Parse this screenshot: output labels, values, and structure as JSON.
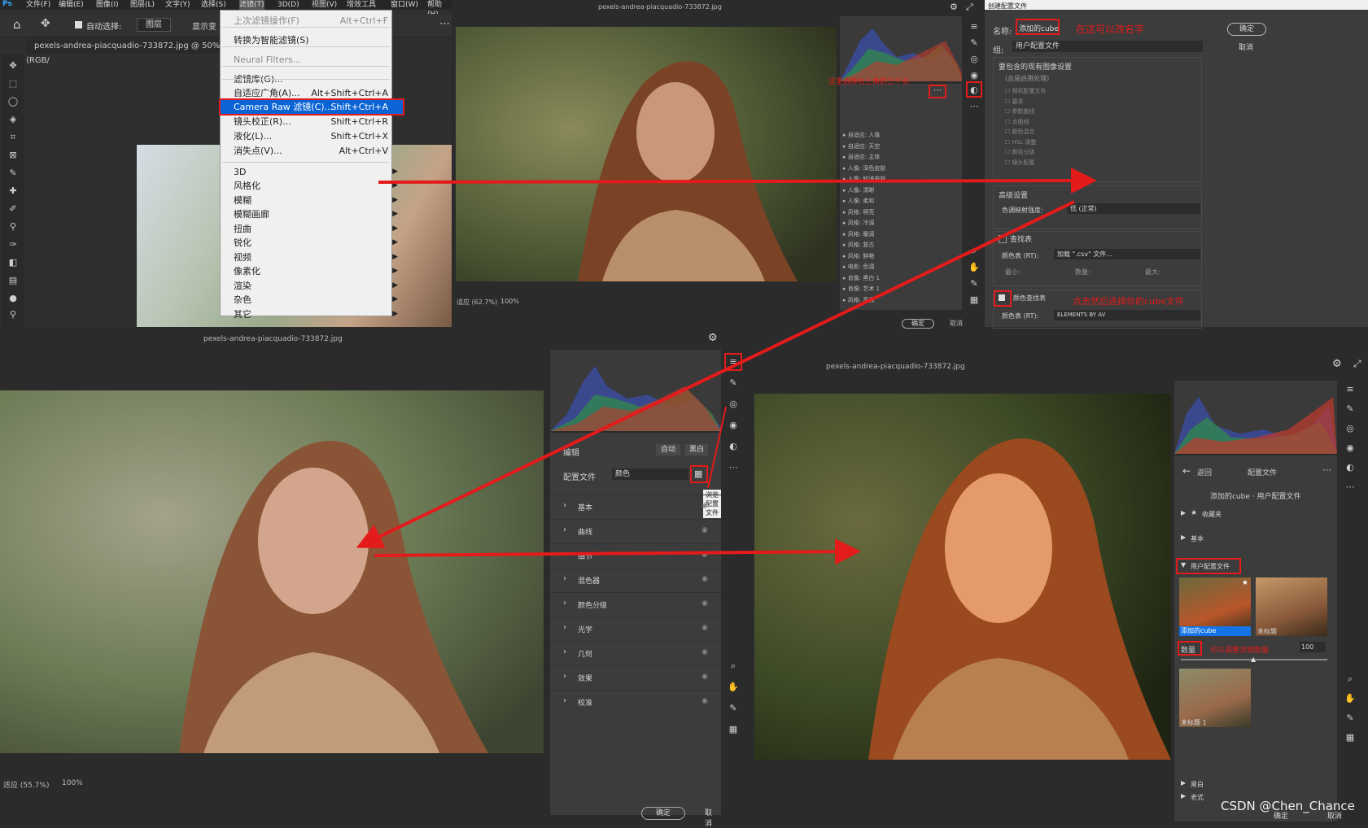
{
  "ps_menubar": {
    "logo": "Ps",
    "items": [
      "文件(F)",
      "编辑(E)",
      "图像(I)",
      "图层(L)",
      "文字(Y)",
      "选择(S)",
      "滤镜(T)",
      "3D(D)",
      "视图(V)",
      "增效工具",
      "窗口(W)",
      "帮助(H)"
    ]
  },
  "ps_options": {
    "auto_select_label": "自动选择:",
    "layer_select": "图层",
    "show_transform": "显示变"
  },
  "ps_tab": {
    "title": "pexels-andrea-piacquadio-733872.jpg @ 50%(RGB/"
  },
  "filter_menu": {
    "items": [
      {
        "label": "上次滤镜操作(F)",
        "shortcut": "Alt+Ctrl+F",
        "disabled": true
      },
      {
        "label": "转换为智能滤镜(S)",
        "shortcut": ""
      },
      {
        "label": "Neural Filters...",
        "shortcut": "",
        "disabled": true
      },
      {
        "label": "滤镜库(G)...",
        "shortcut": ""
      },
      {
        "label": "自适应广角(A)...",
        "shortcut": "Alt+Shift+Ctrl+A"
      },
      {
        "label": "Camera Raw 滤镜(C)...",
        "shortcut": "Shift+Ctrl+A",
        "highlight": true
      },
      {
        "label": "镜头校正(R)...",
        "shortcut": "Shift+Ctrl+R"
      },
      {
        "label": "液化(L)...",
        "shortcut": "Shift+Ctrl+X"
      },
      {
        "label": "消失点(V)...",
        "shortcut": "Alt+Ctrl+V"
      },
      {
        "label": "3D",
        "submenu": true
      },
      {
        "label": "风格化",
        "submenu": true
      },
      {
        "label": "模糊",
        "submenu": true
      },
      {
        "label": "模糊画廊",
        "submenu": true
      },
      {
        "label": "扭曲",
        "submenu": true
      },
      {
        "label": "锐化",
        "submenu": true
      },
      {
        "label": "视频",
        "submenu": true
      },
      {
        "label": "像素化",
        "submenu": true
      },
      {
        "label": "渲染",
        "submenu": true
      },
      {
        "label": "杂色",
        "submenu": true
      },
      {
        "label": "其它",
        "submenu": true
      }
    ]
  },
  "top_cr": {
    "title": "pexels-andrea-piacquadio-733872.jpg",
    "annotation": "这里选择右上角的三个点",
    "zoom_fit": "适应 (62.7%)",
    "zoom": "100%",
    "ok": "确定",
    "cancel": "取消",
    "preset_groups": [
      "自适应: 人像",
      "自适应: 天空",
      "自适应: 主体",
      "人像: 深色皮肤",
      "人像: 较浅皮肤",
      "人像: 清晰",
      "人像: 柔和",
      "风格: 明亮",
      "风格: 冷调",
      "风格: 暖调",
      "风格: 复古",
      "风格: 鲜艳",
      "电影: 色调",
      "肖像: 黑白 1",
      "肖像: 艺术 1",
      "风格: 高调"
    ]
  },
  "create_profile_dialog": {
    "title": "创建配置文件",
    "name_label": "名称:",
    "name_value": "添加的cube",
    "name_annotation": "在这可以改名字",
    "group_label": "组:",
    "group_value": "用户配置文件",
    "ok": "确定",
    "cancel": "取消",
    "settings_title": "要包含的现有图像设置",
    "settings_note": "(总是启用处理)",
    "settings_items": [
      "相机配置文件",
      "基本",
      "参数曲线",
      "点曲线",
      "颜色混合",
      "HSL 调整",
      "颜色分级",
      "镜头配置"
    ],
    "advanced": "高级设置",
    "color_space_label": "色调映射强度:",
    "color_space_value": "低 (正常)",
    "lookup_label": "查找表",
    "color_table_label": "颜色表 (RT):",
    "color_table_value": "加载 \".csv\" 文件...",
    "min_label": "最小:",
    "amount_label": "数量:",
    "max_label": "最大:",
    "color_lookup_label": "颜色查找表",
    "color_lookup_annotation": "点击然后选择你的cube文件",
    "color_lookup_value": "ELEMENTS BY AV"
  },
  "bottom_left_cr": {
    "title": "pexels-andrea-piacquadio-733872.jpg",
    "edit_label": "编辑",
    "auto": "自动",
    "bw": "黑白",
    "profile_label": "配置文件",
    "profile_value": "颜色",
    "tooltip": "浏览配置文件",
    "sections": [
      "基本",
      "曲线",
      "细节",
      "混色器",
      "颜色分级",
      "光学",
      "几何",
      "效果",
      "校准"
    ],
    "zoom_fit": "适应 (55.7%)",
    "zoom": "100%",
    "ok": "确定",
    "cancel": "取消"
  },
  "bottom_right_cr": {
    "title": "pexels-andrea-piacquadio-733872.jpg",
    "back": "返回",
    "profiles_header": "配置文件",
    "subtitle": "添加的cube · 用户配置文件",
    "sections": [
      "收藏夹",
      "基本",
      "用户配置文件",
      "黑白",
      "老式"
    ],
    "thumb1_label": "添加的cube",
    "thumb2_label": "未标题",
    "thumb3_label": "未标题 1",
    "amount_label": "数量",
    "amount_annotation": "可以调整滤镜数量",
    "amount_value": "100",
    "ok": "确定",
    "cancel": "取消"
  },
  "watermark": "CSDN @Chen_Chance",
  "colors": {
    "annotation_red": "#e31b1b",
    "menu_highlight": "#0a64d6",
    "ps_dark": "#323232",
    "panel": "#3c3c3c"
  }
}
